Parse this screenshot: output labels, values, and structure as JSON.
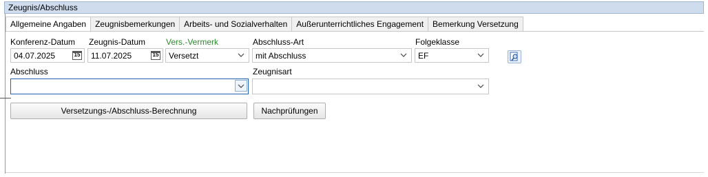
{
  "window": {
    "title": "Zeugnis/Abschluss"
  },
  "tabs": [
    {
      "label": "Allgemeine Angaben",
      "active": true
    },
    {
      "label": "Zeugnisbemerkungen",
      "active": false
    },
    {
      "label": "Arbeits- und Sozialverhalten",
      "active": false
    },
    {
      "label": "Außerunterrichtliches Engagement",
      "active": false
    },
    {
      "label": "Bemerkung Versetzung",
      "active": false
    }
  ],
  "form": {
    "konferenz_datum": {
      "label": "Konferenz-Datum",
      "value": "04.07.2025"
    },
    "zeugnis_datum": {
      "label": "Zeugnis-Datum",
      "value": "11.07.2025"
    },
    "vers_vermerk": {
      "label": "Vers.-Vermerk",
      "value": "Versetzt"
    },
    "abschluss_art": {
      "label": "Abschluss-Art",
      "value": "mit Abschluss"
    },
    "folgeklasse": {
      "label": "Folgeklasse",
      "value": "EF"
    },
    "abschluss": {
      "label": "Abschluss",
      "value": ""
    },
    "zeugnisart": {
      "label": "Zeugnisart",
      "value": ""
    },
    "calendar_glyph": "15"
  },
  "buttons": {
    "berechnung": "Versetzungs-/Abschluss-Berechnung",
    "nachpruefungen": "Nachprüfungen"
  },
  "colors": {
    "accent_green": "#2a8a2a",
    "title_bar": "#cfdcee",
    "focus_border": "#1f5fb0"
  },
  "icons": {
    "calendar": "calendar-icon",
    "dropdown": "chevron-down-icon",
    "lookup": "search-document-icon"
  }
}
